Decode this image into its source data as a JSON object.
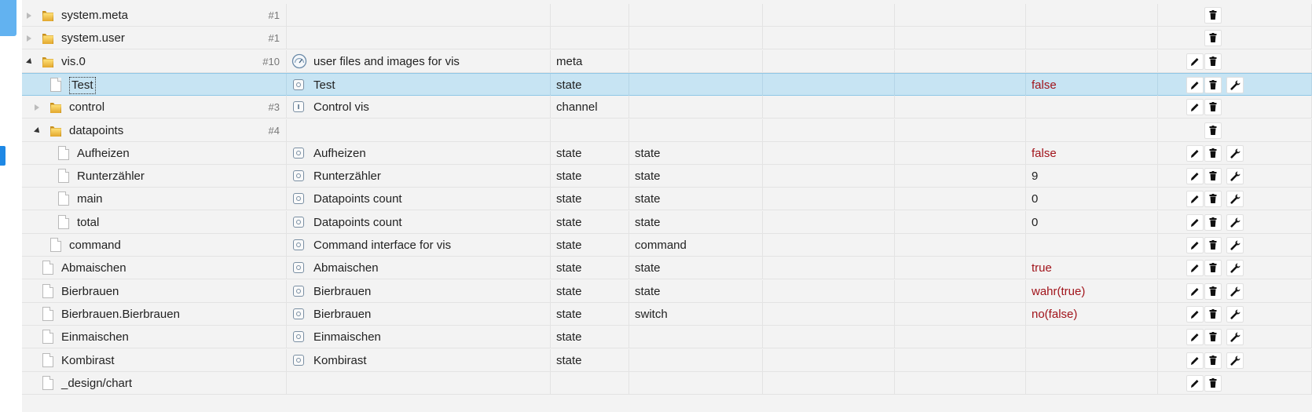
{
  "colors": {
    "value": "#a1141b",
    "accent": "#1e88e5",
    "selected_row": "#c7e4f3"
  },
  "rows": [
    {
      "name": "system.meta",
      "count": "#1",
      "desc": "",
      "type": "",
      "role": "",
      "value": "",
      "icon": "folder",
      "expander": "collapsed",
      "indent": 0,
      "role_icon": "none",
      "buttons": [
        "delete"
      ]
    },
    {
      "name": "system.user",
      "count": "#1",
      "desc": "",
      "type": "",
      "role": "",
      "value": "",
      "icon": "folder",
      "expander": "collapsed",
      "indent": 0,
      "role_icon": "none",
      "buttons": [
        "delete"
      ]
    },
    {
      "name": "vis.0",
      "count": "#10",
      "desc": "user files and images for vis",
      "type": "meta",
      "role": "",
      "value": "",
      "icon": "folder",
      "expander": "expanded",
      "indent": 0,
      "role_icon": "gauge",
      "buttons": [
        "edit",
        "delete"
      ]
    },
    {
      "name": "Test",
      "count": "",
      "desc": "Test",
      "type": "state",
      "role": "",
      "value": "false",
      "icon": "file",
      "expander": "none",
      "indent": 1,
      "role_icon": "state",
      "buttons": [
        "edit",
        "delete",
        "wrench"
      ],
      "selected": true
    },
    {
      "name": "control",
      "count": "#3",
      "desc": "Control vis",
      "type": "channel",
      "role": "",
      "value": "",
      "icon": "folder",
      "expander": "collapsed",
      "indent": 1,
      "role_icon": "channel",
      "buttons": [
        "edit",
        "delete"
      ]
    },
    {
      "name": "datapoints",
      "count": "#4",
      "desc": "",
      "type": "",
      "role": "",
      "value": "",
      "icon": "folder",
      "expander": "expanded",
      "indent": 1,
      "role_icon": "none",
      "buttons": [
        "delete"
      ]
    },
    {
      "name": "Aufheizen",
      "count": "",
      "desc": "Aufheizen",
      "type": "state",
      "role": "state",
      "value": "false",
      "icon": "file",
      "expander": "none",
      "indent": 2,
      "role_icon": "state",
      "buttons": [
        "edit",
        "delete",
        "wrench"
      ]
    },
    {
      "name": "Runterzähler",
      "count": "",
      "desc": "Runterzähler",
      "type": "state",
      "role": "state",
      "value": "9",
      "icon": "file",
      "expander": "none",
      "indent": 2,
      "role_icon": "state",
      "buttons": [
        "edit",
        "delete",
        "wrench"
      ]
    },
    {
      "name": "main",
      "count": "",
      "desc": "Datapoints count",
      "type": "state",
      "role": "state",
      "value": "0",
      "icon": "file",
      "expander": "none",
      "indent": 2,
      "role_icon": "state",
      "buttons": [
        "edit",
        "delete",
        "wrench"
      ]
    },
    {
      "name": "total",
      "count": "",
      "desc": "Datapoints count",
      "type": "state",
      "role": "state",
      "value": "0",
      "icon": "file",
      "expander": "none",
      "indent": 2,
      "role_icon": "state",
      "buttons": [
        "edit",
        "delete",
        "wrench"
      ]
    },
    {
      "name": "command",
      "count": "",
      "desc": "Command interface for vis",
      "type": "state",
      "role": "command",
      "value": "",
      "icon": "file",
      "expander": "none",
      "indent": 1,
      "role_icon": "state",
      "buttons": [
        "edit",
        "delete",
        "wrench"
      ]
    },
    {
      "name": "Abmaischen",
      "count": "",
      "desc": "Abmaischen",
      "type": "state",
      "role": "state",
      "value": "true",
      "icon": "file",
      "expander": "none",
      "indent": 0,
      "role_icon": "state",
      "buttons": [
        "edit",
        "delete",
        "wrench"
      ]
    },
    {
      "name": "Bierbrauen",
      "count": "",
      "desc": "Bierbrauen",
      "type": "state",
      "role": "state",
      "value": "wahr(true)",
      "icon": "file",
      "expander": "none",
      "indent": 0,
      "role_icon": "state",
      "buttons": [
        "edit",
        "delete",
        "wrench"
      ]
    },
    {
      "name": "Bierbrauen.Bierbrauen",
      "count": "",
      "desc": "Bierbrauen",
      "type": "state",
      "role": "switch",
      "value": "no(false)",
      "icon": "file",
      "expander": "none",
      "indent": 0,
      "role_icon": "state",
      "buttons": [
        "edit",
        "delete",
        "wrench"
      ]
    },
    {
      "name": "Einmaischen",
      "count": "",
      "desc": "Einmaischen",
      "type": "state",
      "role": "",
      "value": "",
      "icon": "file",
      "expander": "none",
      "indent": 0,
      "role_icon": "state",
      "buttons": [
        "edit",
        "delete",
        "wrench"
      ]
    },
    {
      "name": "Kombirast",
      "count": "",
      "desc": "Kombirast",
      "type": "state",
      "role": "",
      "value": "",
      "icon": "file",
      "expander": "none",
      "indent": 0,
      "role_icon": "state",
      "buttons": [
        "edit",
        "delete",
        "wrench"
      ]
    },
    {
      "name": "_design/chart",
      "count": "",
      "desc": "",
      "type": "",
      "role": "",
      "value": "",
      "icon": "file",
      "expander": "none",
      "indent": 0,
      "role_icon": "none",
      "buttons": [
        "edit",
        "delete"
      ]
    }
  ]
}
